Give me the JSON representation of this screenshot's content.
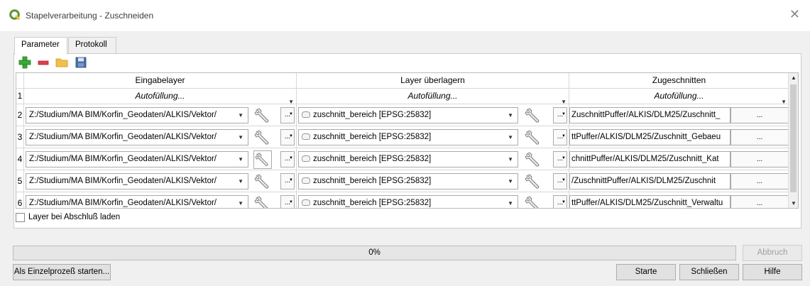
{
  "window": {
    "title": "Stapelverarbeitung - Zuschneiden",
    "close_glyph": "✕"
  },
  "tabs": [
    {
      "label": "Parameter",
      "active": true
    },
    {
      "label": "Protokoll",
      "active": false
    }
  ],
  "toolbar": {
    "icons": [
      "add-row-icon",
      "remove-row-icon",
      "open-folder-icon",
      "save-icon"
    ]
  },
  "table": {
    "columns": [
      "Eingabelayer",
      "Layer überlagern",
      "Zugeschnitten"
    ],
    "autofill_label": "Autofüllung...",
    "row1_number": "1",
    "dots_label": "...",
    "browse_label": "...",
    "rows": [
      {
        "num": "2",
        "input": "Z:/Studium/MA BIM/Korfin_Geodaten/ALKIS/Vektor/",
        "overlay": "zuschnitt_bereich [EPSG:25832]",
        "output": "ZuschnittPuffer/ALKIS/DLM25/Zuschnitt_"
      },
      {
        "num": "3",
        "input": "Z:/Studium/MA BIM/Korfin_Geodaten/ALKIS/Vektor/",
        "overlay": "zuschnitt_bereich [EPSG:25832]",
        "output": "ttPuffer/ALKIS/DLM25/Zuschnitt_Gebaeu"
      },
      {
        "num": "4",
        "input": "Z:/Studium/MA BIM/Korfin_Geodaten/ALKIS/Vektor/",
        "overlay": "zuschnitt_bereich [EPSG:25832]",
        "output": "chnittPuffer/ALKIS/DLM25/Zuschnitt_Kat"
      },
      {
        "num": "5",
        "input": "Z:/Studium/MA BIM/Korfin_Geodaten/ALKIS/Vektor/",
        "overlay": "zuschnitt_bereich [EPSG:25832]",
        "output": "/ZuschnittPuffer/ALKIS/DLM25/Zuschnit"
      },
      {
        "num": "6",
        "input": "Z:/Studium/MA BIM/Korfin_Geodaten/ALKIS/Vektor/",
        "overlay": "zuschnitt_bereich [EPSG:25832]",
        "output": "ttPuffer/ALKIS/DLM25/Zuschnitt_Verwaltu"
      }
    ]
  },
  "load_layers_checkbox": {
    "label": "Layer bei Abschluß laden",
    "checked": false
  },
  "progress": {
    "text": "0%",
    "value": 0
  },
  "buttons": {
    "cancel": "Abbruch",
    "single": "Als Einzelprozeß starten...",
    "start": "Starte",
    "close": "Schließen",
    "help": "Hilfe"
  },
  "colors": {
    "qgis_green": "#589632",
    "add_green": "#3aa83a",
    "remove_red": "#e0404f",
    "folder_yellow": "#f2c04a",
    "save_blue": "#4a6fa8"
  }
}
